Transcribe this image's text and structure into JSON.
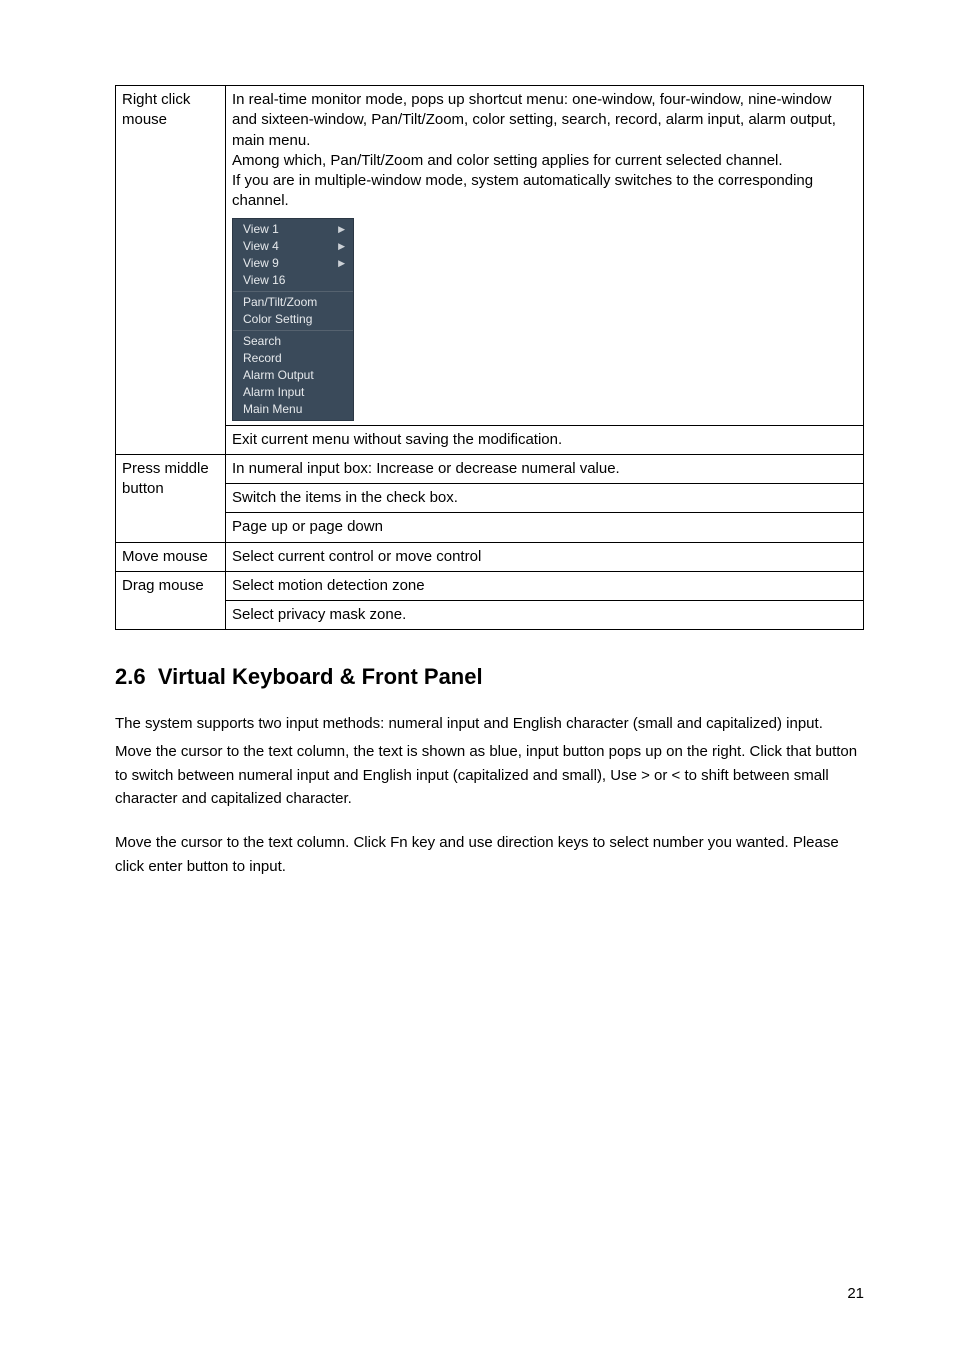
{
  "table": {
    "rows": [
      {
        "label": "Right click mouse",
        "cells": [
          {
            "paragraphs": [
              "In real-time monitor mode, pops up shortcut menu: one-window, four-window, nine-window and sixteen-window, Pan/Tilt/Zoom, color setting, search, record, alarm input, alarm output, main menu.",
              "Among which, Pan/Tilt/Zoom and color setting applies for current selected channel.",
              "If you are in multiple-window mode, system automatically switches to the corresponding channel."
            ],
            "menu": {
              "groups": [
                [
                  {
                    "label": "View 1",
                    "arrow": true
                  },
                  {
                    "label": "View 4",
                    "arrow": true
                  },
                  {
                    "label": "View 9",
                    "arrow": true
                  },
                  {
                    "label": "View 16",
                    "arrow": false
                  }
                ],
                [
                  {
                    "label": "Pan/Tilt/Zoom",
                    "arrow": false
                  },
                  {
                    "label": "Color Setting",
                    "arrow": false
                  }
                ],
                [
                  {
                    "label": "Search",
                    "arrow": false
                  },
                  {
                    "label": "Record",
                    "arrow": false
                  },
                  {
                    "label": "Alarm Output",
                    "arrow": false
                  },
                  {
                    "label": "Alarm Input",
                    "arrow": false
                  },
                  {
                    "label": "Main Menu",
                    "arrow": false
                  }
                ]
              ]
            }
          },
          {
            "text": "Exit current menu without saving the modification."
          }
        ]
      },
      {
        "label": "Press middle button",
        "cells": [
          {
            "text": "In numeral input box:  Increase or decrease numeral value."
          },
          {
            "text": "Switch the items in the check box."
          },
          {
            "text": "Page up or page down"
          }
        ]
      },
      {
        "label": "Move mouse",
        "cells": [
          {
            "text": "Select current control or move control"
          }
        ]
      },
      {
        "label": "Drag mouse",
        "cells": [
          {
            "text": "Select motion detection zone"
          },
          {
            "text": "Select privacy mask zone."
          }
        ]
      }
    ]
  },
  "section": {
    "number": "2.6",
    "title": "Virtual Keyboard & Front Panel"
  },
  "paragraphs": {
    "p1": "The system supports two input methods: numeral input and English character (small and capitalized) input.",
    "p2": "Move the cursor to the text column, the text is shown as blue, input button pops up on the right. Click that button to switch between numeral input and English input (capitalized and small), Use > or < to shift between small character and capitalized character.",
    "p3": "Move the cursor to the text column. Click Fn key and use direction keys to select number you wanted.  Please click enter button to input."
  },
  "page_number": "21"
}
